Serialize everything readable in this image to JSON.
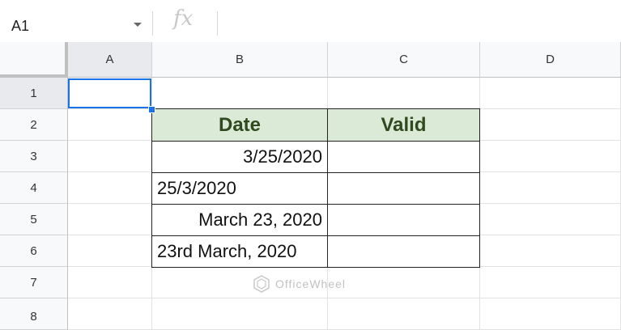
{
  "formula_bar": {
    "name_box": "A1",
    "fx_label": "fx",
    "formula": ""
  },
  "columns": [
    "A",
    "B",
    "C",
    "D"
  ],
  "rows": [
    "1",
    "2",
    "3",
    "4",
    "5",
    "6",
    "7",
    "8"
  ],
  "table": {
    "headers": [
      "Date",
      "Valid"
    ],
    "dates": [
      "3/25/2020",
      "25/3/2020",
      "March 23, 2020",
      "23rd March, 2020"
    ],
    "valid": [
      "",
      "",
      "",
      ""
    ]
  },
  "watermark": "OfficeWheel",
  "colors": {
    "header_fill": "#dbead6",
    "header_text": "#2f4a1e",
    "selection": "#1a73e8"
  }
}
